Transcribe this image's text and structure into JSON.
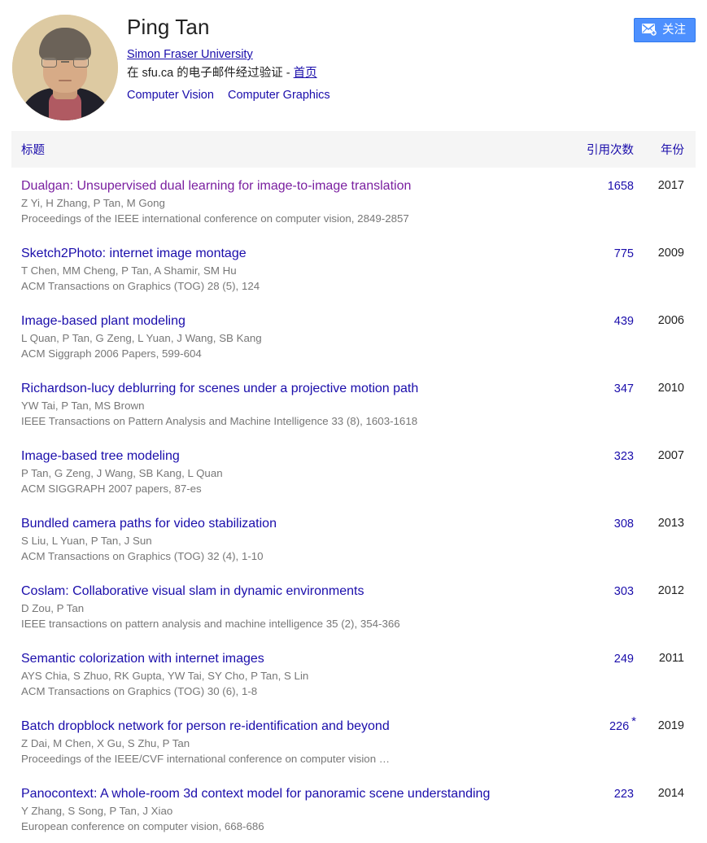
{
  "theme": {
    "link_blue": "#1a0dab",
    "visited_purple": "#7a1fa0",
    "button_blue": "#4d90fe",
    "header_gray": "#f5f5f5",
    "meta_gray": "#777777"
  },
  "profile": {
    "name": "Ping Tan",
    "affiliation": "Simon Fraser University",
    "verified_prefix": "在 sfu.ca 的电子邮件经过验证 - ",
    "homepage_label": "首页",
    "interests": [
      {
        "label": "Computer Vision"
      },
      {
        "label": "Computer Graphics"
      }
    ],
    "avatar_alt": "Ping Tan"
  },
  "follow": {
    "label": "关注",
    "icon": "envelope-plus-icon"
  },
  "table": {
    "headers": {
      "title": "标题",
      "citations": "引用次数",
      "year": "年份"
    },
    "rows": [
      {
        "title": "Dualgan: Unsupervised dual learning for image-to-image translation",
        "authors": "Z Yi, H Zhang, P Tan, M Gong",
        "venue": "Proceedings of the IEEE international conference on computer vision, 2849-2857",
        "citations": "1658",
        "star": "",
        "year": "2017",
        "visited": true
      },
      {
        "title": "Sketch2Photo: internet image montage",
        "authors": "T Chen, MM Cheng, P Tan, A Shamir, SM Hu",
        "venue": "ACM Transactions on Graphics (TOG) 28 (5), 124",
        "citations": "775",
        "star": "",
        "year": "2009",
        "visited": false
      },
      {
        "title": "Image-based plant modeling",
        "authors": "L Quan, P Tan, G Zeng, L Yuan, J Wang, SB Kang",
        "venue": "ACM Siggraph 2006 Papers, 599-604",
        "citations": "439",
        "star": "",
        "year": "2006",
        "visited": false
      },
      {
        "title": "Richardson-lucy deblurring for scenes under a projective motion path",
        "authors": "YW Tai, P Tan, MS Brown",
        "venue": "IEEE Transactions on Pattern Analysis and Machine Intelligence 33 (8), 1603-1618",
        "citations": "347",
        "star": "",
        "year": "2010",
        "visited": false
      },
      {
        "title": "Image-based tree modeling",
        "authors": "P Tan, G Zeng, J Wang, SB Kang, L Quan",
        "venue": "ACM SIGGRAPH 2007 papers, 87-es",
        "citations": "323",
        "star": "",
        "year": "2007",
        "visited": false
      },
      {
        "title": "Bundled camera paths for video stabilization",
        "authors": "S Liu, L Yuan, P Tan, J Sun",
        "venue": "ACM Transactions on Graphics (TOG) 32 (4), 1-10",
        "citations": "308",
        "star": "",
        "year": "2013",
        "visited": false
      },
      {
        "title": "Coslam: Collaborative visual slam in dynamic environments",
        "authors": "D Zou, P Tan",
        "venue": "IEEE transactions on pattern analysis and machine intelligence 35 (2), 354-366",
        "citations": "303",
        "star": "",
        "year": "2012",
        "visited": false
      },
      {
        "title": "Semantic colorization with internet images",
        "authors": "AYS Chia, S Zhuo, RK Gupta, YW Tai, SY Cho, P Tan, S Lin",
        "venue": "ACM Transactions on Graphics (TOG) 30 (6), 1-8",
        "citations": "249",
        "star": "",
        "year": "2011",
        "visited": false
      },
      {
        "title": "Batch dropblock network for person re-identification and beyond",
        "authors": "Z Dai, M Chen, X Gu, S Zhu, P Tan",
        "venue": "Proceedings of the IEEE/CVF international conference on computer vision …",
        "citations": "226",
        "star": "*",
        "year": "2019",
        "visited": false
      },
      {
        "title": "Panocontext: A whole-room 3d context model for panoramic scene understanding",
        "authors": "Y Zhang, S Song, P Tan, J Xiao",
        "venue": "European conference on computer vision, 668-686",
        "citations": "223",
        "star": "",
        "year": "2014",
        "visited": false
      }
    ]
  }
}
